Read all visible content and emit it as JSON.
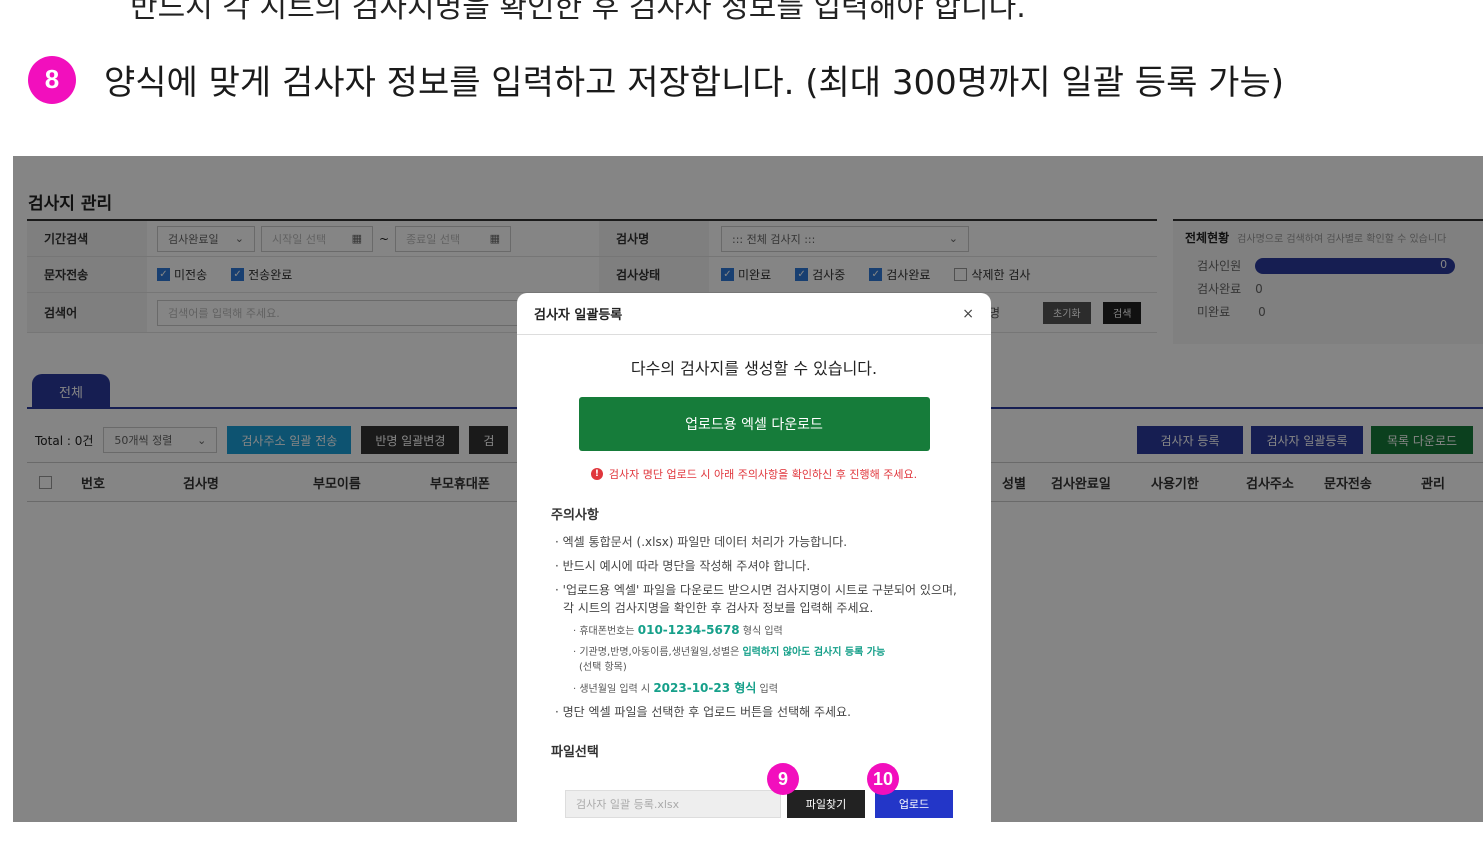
{
  "guide": {
    "top_cut_text": "반드시 각 시트의 검사지명을 확인한 후 검사자 정보를 입력해야 합니다.",
    "step_number": "8",
    "step_text": "양식에 맞게 검사자 정보를 입력하고 저장합니다. (최대 300명까지 일괄 등록 가능)",
    "badge_9": "9",
    "badge_10": "10"
  },
  "page": {
    "title": "검사지 관리",
    "filter": {
      "period_label": "기간검색",
      "period_select": "검사완료일",
      "start_placeholder": "시작일 선택",
      "end_placeholder": "종료일 선택",
      "tilde": "~",
      "name_label": "검사명",
      "name_select": "::: 전체 검사지 :::",
      "sms_label": "문자전송",
      "sms_options": [
        "미전송",
        "전송완료"
      ],
      "status_label": "검사상태",
      "status_options": [
        "미완료",
        "검사중",
        "검사완료",
        "삭제한 검사"
      ],
      "keyword_label": "검색어",
      "keyword_placeholder": "검색어를 입력해 주세요.",
      "reset_label": "초기화",
      "search_label": "검색",
      "partial_label": "명"
    },
    "status_panel": {
      "title": "전체현황",
      "hint": "검사명으로 검색하여 검사별로 확인할 수 있습니다",
      "people_label": "검사인원",
      "people_value": "0",
      "done_label": "검사완료",
      "done_value": "0",
      "undone_label": "미완료",
      "undone_value": "0"
    },
    "tab_all": "전체",
    "toolbar": {
      "total": "Total : 0건",
      "sort": "50개씩 정렬",
      "btn_send_all": "검사주소 일괄 전송",
      "btn_class_change": "반명 일괄변경",
      "btn_cut": "검",
      "btn_register": "검사자 등록",
      "btn_bulk_register": "검사자 일괄등록",
      "btn_download_list": "목록 다운로드"
    },
    "table_headers": [
      "번호",
      "검사명",
      "부모이름",
      "부모휴대폰",
      "성별",
      "검사완료일",
      "사용기한",
      "검사주소",
      "문자전송",
      "관리"
    ]
  },
  "modal": {
    "title": "검사자 일괄등록",
    "close": "×",
    "subtitle": "다수의 검사지를 생성할 수 있습니다.",
    "download_btn": "업로드용 엑셀 다운로드",
    "warning": "검사자 명단 업로드 시 아래 주의사항을 확인하신 후 진행해 주세요.",
    "notes_title": "주의사항",
    "note1": "엑셀 통합문서 (.xlsx) 파일만 데이터 처리가 가능합니다.",
    "note2": "반드시 예시에 따라 명단을 작성해 주셔야 합니다.",
    "note3": "'업로드용 엑셀' 파일을 다운로드 받으시면 검사지명이 시트로 구분되어 있으며, 각 시트의 검사지명을 확인한 후 검사자 정보를 입력해 주세요.",
    "sub1_pre": "휴대폰번호는",
    "sub1_hl": "010-1234-5678",
    "sub1_post": "형식 입력",
    "sub2_pre": "기관명,반명,아동이름,생년월일,성별은",
    "sub2_hl": "입력하지 않아도 검사지 등록 가능",
    "sub2_post": "(선택 항목)",
    "sub3_pre": "생년월일 입력 시",
    "sub3_hl": "2023-10-23 형식",
    "sub3_post": "입력",
    "note4": "명단 엑셀 파일을 선택한 후 업로드 버튼을 선택해 주세요.",
    "file_title": "파일선택",
    "file_value": "검사자 일괄 등록.xlsx",
    "find_btn": "파일찾기",
    "upload_btn": "업로드"
  },
  "colors": {
    "badge": "#f20fbd",
    "primary": "#2b3a9e",
    "download_green": "#167c3a",
    "highlight": "#16a08a",
    "warning": "#e0363c"
  }
}
